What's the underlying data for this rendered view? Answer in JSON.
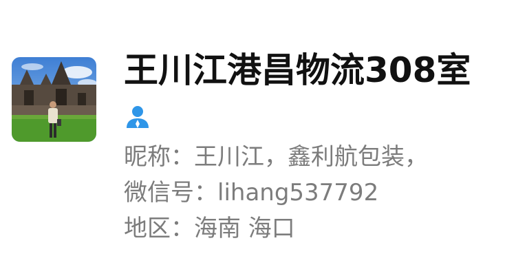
{
  "profile": {
    "display_name": "王川江港昌物流308室",
    "gender_icon": "person-icon",
    "avatar_icon": "avatar-photo-temple",
    "nickname_label": "昵称：",
    "nickname_value": "王川江，鑫利航包装，",
    "wechat_id_label": "微信号：",
    "wechat_id_value": "lihang537792",
    "region_label": "地区：",
    "region_value": "海南 海口"
  },
  "colors": {
    "name_text": "#111111",
    "secondary_text": "#7c7c7c",
    "gender_icon": "#2f96e8",
    "background": "#ffffff"
  }
}
